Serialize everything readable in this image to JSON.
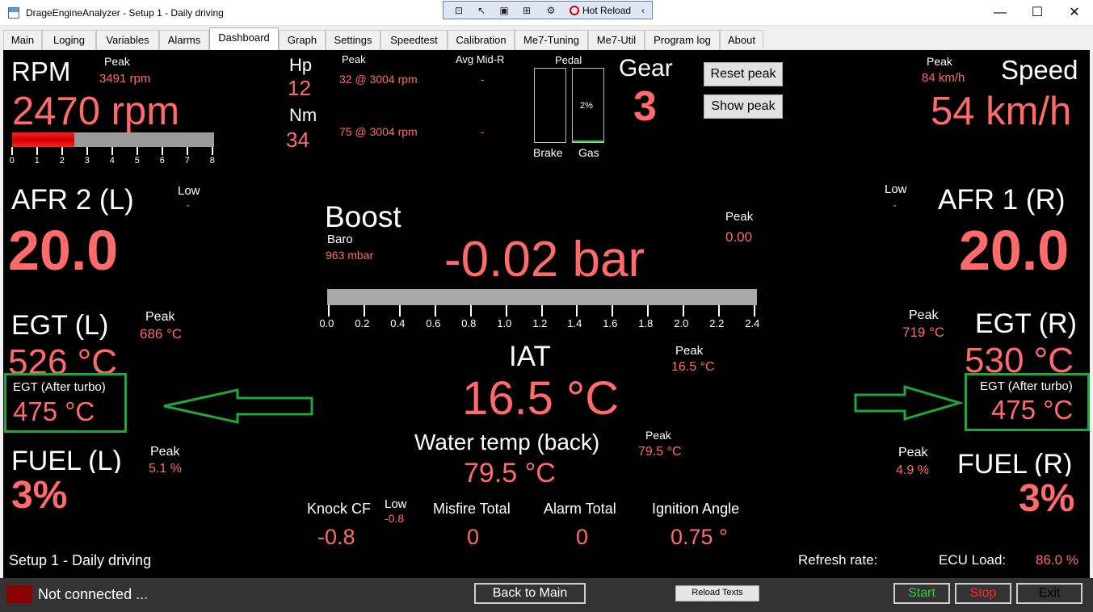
{
  "window": {
    "title": "DrageEngineAnalyzer - Setup 1 - Daily driving",
    "minimize": "—",
    "maximize": "☐",
    "close": "✕"
  },
  "hot_reload": {
    "label": "Hot Reload",
    "collapse": "‹"
  },
  "tabs": [
    "Main",
    "Loging",
    "Variables",
    "Alarms",
    "Dashboard",
    "Graph",
    "Settings",
    "Speedtest",
    "Calibration",
    "Me7-Tuning",
    "Me7-Util",
    "Program log",
    "About"
  ],
  "active_tab": "Dashboard",
  "rpm": {
    "label": "RPM",
    "value": "2470 rpm",
    "peak_label": "Peak",
    "peak": "3491 rpm",
    "bar_fraction": 0.309,
    "scale": [
      "0",
      "1",
      "2",
      "3",
      "4",
      "5",
      "6",
      "7",
      "8"
    ]
  },
  "power": {
    "hp_label": "Hp",
    "hp": "12",
    "nm_label": "Nm",
    "nm": "34",
    "peak_label": "Peak",
    "hp_peak": "32 @ 3004 rpm",
    "nm_peak": "75 @ 3004 rpm",
    "avg_label": "Avg Mid-R",
    "hp_avg": "-",
    "nm_avg": "-"
  },
  "pedal": {
    "label": "Pedal",
    "brake_label": "Brake",
    "gas_label": "Gas",
    "gas_value": "2%",
    "brake_fraction": 0,
    "gas_fraction": 0.02
  },
  "gear": {
    "label": "Gear",
    "value": "3"
  },
  "buttons": {
    "reset_peak": "Reset peak",
    "show_peak": "Show peak"
  },
  "speed": {
    "label": "Speed",
    "value": "54 km/h",
    "peak_label": "Peak",
    "peak": "84 km/h"
  },
  "afr_left": {
    "label": "AFR  2 (L)",
    "value": "20.0",
    "low_label": "Low",
    "low": "-"
  },
  "afr_right": {
    "label": "AFR  1 (R)",
    "value": "20.0",
    "low_label": "Low",
    "low": "-"
  },
  "boost": {
    "label": "Boost",
    "value": "-0.02 bar",
    "baro_label": "Baro",
    "baro": "963 mbar",
    "peak_label": "Peak",
    "peak": "0.00",
    "scale": [
      "0.0",
      "0.2",
      "0.4",
      "0.6",
      "0.8",
      "1.0",
      "1.2",
      "1.4",
      "1.6",
      "1.8",
      "2.0",
      "2.2",
      "2.4"
    ],
    "bar_fraction": 0
  },
  "egt_left": {
    "label": "EGT (L)",
    "value": "526 °C",
    "peak_label": "Peak",
    "peak": "686 °C",
    "after_turbo_label": "EGT (After turbo)",
    "after_turbo": "475 °C"
  },
  "egt_right": {
    "label": "EGT (R)",
    "value": "530 °C",
    "peak_label": "Peak",
    "peak": "719 °C",
    "after_turbo_label": "EGT (After turbo)",
    "after_turbo": "475 °C"
  },
  "iat": {
    "label": "IAT",
    "value": "16.5 °C",
    "peak_label": "Peak",
    "peak": "16.5 °C"
  },
  "water": {
    "label": "Water temp (back)",
    "value": "79.5 °C",
    "peak_label": "Peak",
    "peak": "79.5 °C"
  },
  "fuel_left": {
    "label": "FUEL (L)",
    "value": "3%",
    "peak_label": "Peak",
    "peak": "5.1 %"
  },
  "fuel_right": {
    "label": "FUEL (R)",
    "value": "3%",
    "peak_label": "Peak",
    "peak": "4.9 %"
  },
  "knock": {
    "label": "Knock CF",
    "value": "-0.8",
    "low_label": "Low",
    "low": "-0.8"
  },
  "misfire": {
    "label": "Misfire Total",
    "value": "0"
  },
  "alarm": {
    "label": "Alarm Total",
    "value": "0"
  },
  "ignition": {
    "label": "Ignition Angle",
    "value": "0.75 °"
  },
  "footer": {
    "setup": "Setup 1 - Daily driving",
    "refresh_label": "Refresh rate:",
    "ecu_label": "ECU Load:",
    "ecu_value": "86.0 %"
  },
  "status": {
    "connection": "Not connected ...",
    "back": "Back to Main",
    "reload": "Reload Texts",
    "start": "Start",
    "stop": "Stop",
    "exit": "Exit"
  },
  "colors": {
    "value": "#ff6b6b",
    "label": "#ffffff",
    "highlight": "#1ea83c",
    "start": "#2ecc40",
    "stop": "#ff2a2a",
    "indicator": "#8b0000"
  }
}
